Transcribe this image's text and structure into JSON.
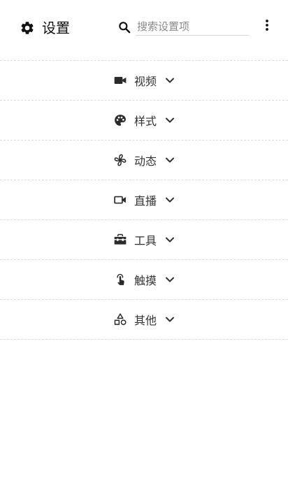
{
  "header": {
    "title": "设置",
    "title_icon": "gear-icon",
    "search": {
      "placeholder": "搜索设置项",
      "value": "",
      "icon": "search-icon"
    },
    "menu_icon": "more-vert-icon"
  },
  "sections": [
    {
      "id": "video",
      "label": "视频",
      "icon": "videocam-icon"
    },
    {
      "id": "style",
      "label": "样式",
      "icon": "palette-icon"
    },
    {
      "id": "dynamic",
      "label": "动态",
      "icon": "fan-icon"
    },
    {
      "id": "live",
      "label": "直播",
      "icon": "video-camera-outline-icon"
    },
    {
      "id": "tools",
      "label": "工具",
      "icon": "toolbox-icon"
    },
    {
      "id": "touch",
      "label": "触摸",
      "icon": "touch-icon"
    },
    {
      "id": "other",
      "label": "其他",
      "icon": "shapes-icon"
    }
  ],
  "colors": {
    "text": "#333333",
    "icon": "#2b2b2b",
    "divider": "#dcdcdc"
  }
}
